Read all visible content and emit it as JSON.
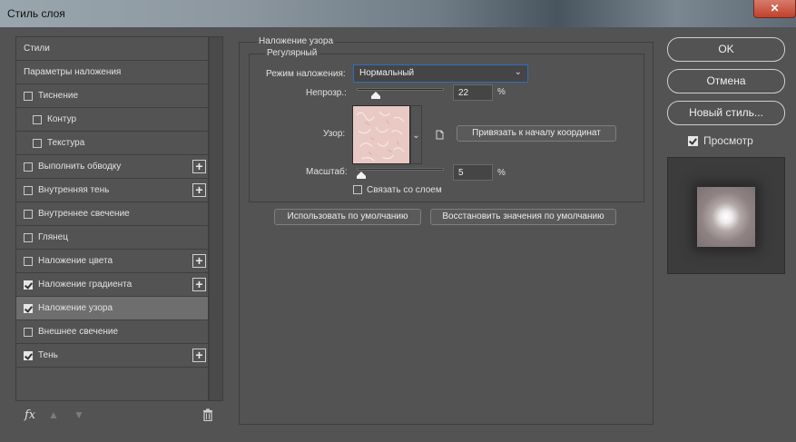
{
  "window": {
    "title": "Стиль слоя",
    "close_label": "✕"
  },
  "styles_list": {
    "items": [
      {
        "label": "Стили",
        "checkbox": false,
        "checked": false,
        "indent": false,
        "plus": false,
        "selected": false
      },
      {
        "label": "Параметры наложения",
        "checkbox": false,
        "checked": false,
        "indent": false,
        "plus": false,
        "selected": false
      },
      {
        "label": "Тиснение",
        "checkbox": true,
        "checked": false,
        "indent": false,
        "plus": false,
        "selected": false
      },
      {
        "label": "Контур",
        "checkbox": true,
        "checked": false,
        "indent": true,
        "plus": false,
        "selected": false
      },
      {
        "label": "Текстура",
        "checkbox": true,
        "checked": false,
        "indent": true,
        "plus": false,
        "selected": false
      },
      {
        "label": "Выполнить обводку",
        "checkbox": true,
        "checked": false,
        "indent": false,
        "plus": true,
        "selected": false
      },
      {
        "label": "Внутренняя тень",
        "checkbox": true,
        "checked": false,
        "indent": false,
        "plus": true,
        "selected": false
      },
      {
        "label": "Внутреннее свечение",
        "checkbox": true,
        "checked": false,
        "indent": false,
        "plus": false,
        "selected": false
      },
      {
        "label": "Глянец",
        "checkbox": true,
        "checked": false,
        "indent": false,
        "plus": false,
        "selected": false
      },
      {
        "label": "Наложение цвета",
        "checkbox": true,
        "checked": false,
        "indent": false,
        "plus": true,
        "selected": false
      },
      {
        "label": "Наложение градиента",
        "checkbox": true,
        "checked": true,
        "indent": false,
        "plus": true,
        "selected": false
      },
      {
        "label": "Наложение узора",
        "checkbox": true,
        "checked": true,
        "indent": false,
        "plus": false,
        "selected": true
      },
      {
        "label": "Внешнее свечение",
        "checkbox": true,
        "checked": false,
        "indent": false,
        "plus": false,
        "selected": false
      },
      {
        "label": "Тень",
        "checkbox": true,
        "checked": true,
        "indent": false,
        "plus": true,
        "selected": false
      }
    ],
    "fx_label": "fx"
  },
  "pattern_overlay": {
    "group_title": "Наложение узора",
    "subgroup_title": "Регулярный",
    "blend_mode_label": "Режим наложения:",
    "blend_mode_value": "Нормальный",
    "opacity_label": "Непрозр.:",
    "opacity_value": "22",
    "opacity_level_percent": 22,
    "percent_sign": "%",
    "pattern_label": "Узор:",
    "snap_button": "Привязать к началу координат",
    "scale_label": "Масштаб:",
    "scale_value": "5",
    "scale_level_percent": 5,
    "link_label": "Связать со слоем",
    "link_checked": false,
    "default_button": "Использовать по умолчанию",
    "reset_button": "Восстановить значения по умолчанию",
    "pattern_color": "#e8c9c4"
  },
  "actions": {
    "ok": "OK",
    "cancel": "Отмена",
    "new_style": "Новый стиль...",
    "preview_label": "Просмотр",
    "preview_checked": true
  },
  "colors": {
    "panel": "#535353",
    "selected_row": "#6e6e6e",
    "focus_border": "#2e6fc0"
  }
}
